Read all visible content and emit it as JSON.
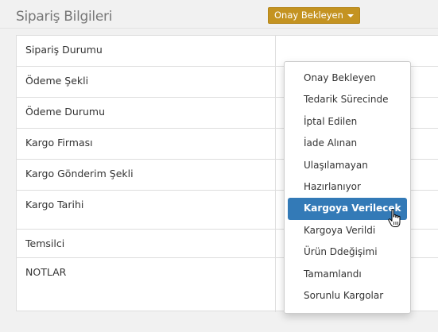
{
  "section": {
    "title": "Sipariş Bilgileri"
  },
  "rows": [
    {
      "label": "Sipariş Durumu"
    },
    {
      "label": "Ödeme Şekli"
    },
    {
      "label": "Ödeme Durumu"
    },
    {
      "label": "Kargo Firması"
    },
    {
      "label": "Kargo Gönderim Şekli"
    },
    {
      "label": "Kargo Tarihi"
    },
    {
      "label": "Temsilci"
    },
    {
      "label": "NOTLAR"
    }
  ],
  "status_dropdown": {
    "button_label": "Onay Bekleyen",
    "button_color": "#c49321",
    "highlight_color": "#337ab7",
    "items": [
      "Onay Bekleyen",
      "Tedarik Sürecinde",
      "İptal Edilen",
      "İade Alınan",
      "Ulaşılamayan",
      "Hazırlanıyor",
      "Kargoya Verilecek",
      "Kargoya Verildi",
      "Ürün Ddeğişimi",
      "Tamamlandı",
      "Sorunlu Kargolar"
    ],
    "hovered_item": "Kargoya Verilecek"
  },
  "cursor": {
    "icon": "hand-pointer-icon"
  }
}
